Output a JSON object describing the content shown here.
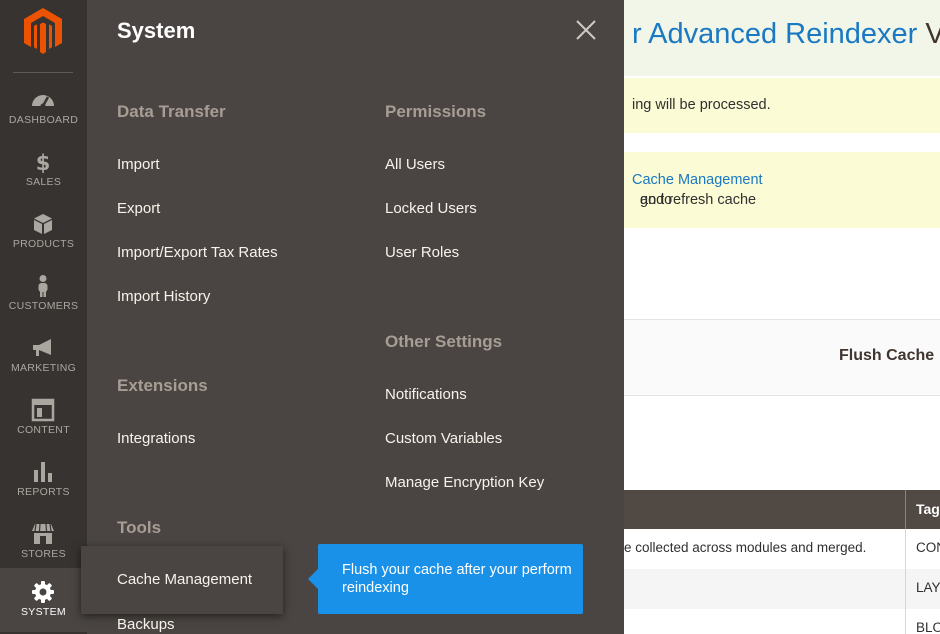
{
  "sidebar": {
    "items": [
      {
        "label": "DASHBOARD",
        "icon": "dashboard-icon"
      },
      {
        "label": "SALES",
        "icon": "dollar-icon"
      },
      {
        "label": "PRODUCTS",
        "icon": "cube-icon"
      },
      {
        "label": "CUSTOMERS",
        "icon": "person-icon"
      },
      {
        "label": "MARKETING",
        "icon": "megaphone-icon"
      },
      {
        "label": "CONTENT",
        "icon": "content-icon"
      },
      {
        "label": "REPORTS",
        "icon": "bar-chart-icon"
      },
      {
        "label": "STORES",
        "icon": "store-icon"
      },
      {
        "label": "SYSTEM",
        "icon": "gear-icon",
        "active": true
      }
    ]
  },
  "menu": {
    "title": "System",
    "sections": {
      "data_transfer": {
        "title": "Data Transfer",
        "items": [
          "Import",
          "Export",
          "Import/Export Tax Rates",
          "Import History"
        ]
      },
      "extensions": {
        "title": "Extensions",
        "items": [
          "Integrations"
        ]
      },
      "tools": {
        "title": "Tools",
        "items": [
          "Cache Management",
          "Backups"
        ]
      },
      "permissions": {
        "title": "Permissions",
        "items": [
          "All Users",
          "Locked Users",
          "User Roles"
        ]
      },
      "other_settings": {
        "title": "Other Settings",
        "items": [
          "Notifications",
          "Custom Variables",
          "Manage Encryption Key"
        ]
      }
    }
  },
  "tooltip": {
    "text": "Flush your cache after your perform reindexing"
  },
  "page": {
    "title_link": "r Advanced Reindexer",
    "title_rest": " Ver",
    "message1": "ing will be processed.",
    "message2_prefix": "go to ",
    "message2_link": "Cache Management",
    "message2_suffix": " and refresh cache",
    "flush_button": "Flush Cache",
    "table": {
      "header_tags": "Tags",
      "rows": [
        {
          "c1": "e collected across modules and merged.",
          "c2": "CON"
        },
        {
          "c1": "",
          "c2": "LAYO"
        },
        {
          "c1": "",
          "c2": "BLO"
        }
      ]
    }
  },
  "colors": {
    "sidebar_bg": "#373330",
    "menu_bg": "#4a4542",
    "accent": "#eb5202",
    "tooltip_bg": "#1a91e8",
    "link": "#1979c3"
  }
}
